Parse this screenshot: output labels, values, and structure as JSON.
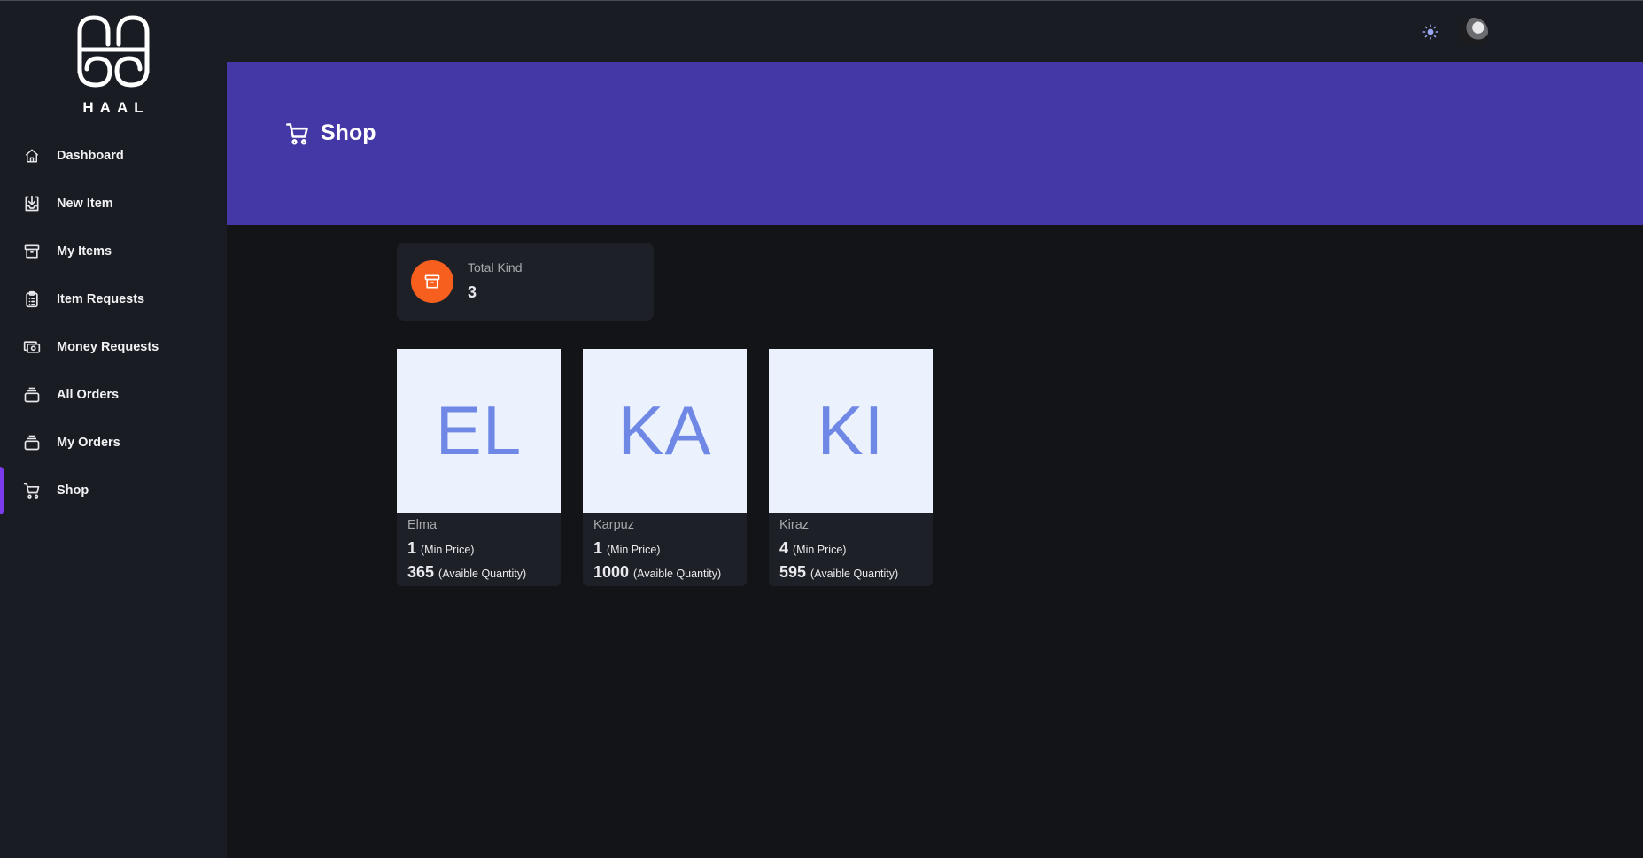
{
  "brand": {
    "name": "HAAL"
  },
  "sidebar": {
    "items": [
      {
        "label": "Dashboard",
        "icon": "home-icon"
      },
      {
        "label": "New Item",
        "icon": "download-box-icon"
      },
      {
        "label": "My Items",
        "icon": "archive-icon"
      },
      {
        "label": "Item Requests",
        "icon": "clipboard-list-icon"
      },
      {
        "label": "Money Requests",
        "icon": "cash-icon"
      },
      {
        "label": "All Orders",
        "icon": "stack-icon"
      },
      {
        "label": "My Orders",
        "icon": "stack-icon"
      },
      {
        "label": "Shop",
        "icon": "cart-icon",
        "active": true
      }
    ]
  },
  "topbar": {
    "theme_icon": "sun-icon",
    "avatar": "user-avatar"
  },
  "header": {
    "title": "Shop",
    "icon": "cart-icon",
    "color": "#4437a6"
  },
  "stats": {
    "label": "Total Kind",
    "value": "3",
    "icon": "archive-icon",
    "color": "#f75f1e"
  },
  "products": [
    {
      "initials": "EL",
      "name": "Elma",
      "min_price": "1",
      "min_price_label": "(Min Price)",
      "quantity": "365",
      "quantity_label": "(Avaible Quantity)"
    },
    {
      "initials": "KA",
      "name": "Karpuz",
      "min_price": "1",
      "min_price_label": "(Min Price)",
      "quantity": "1000",
      "quantity_label": "(Avaible Quantity)"
    },
    {
      "initials": "KI",
      "name": "Kiraz",
      "min_price": "4",
      "min_price_label": "(Min Price)",
      "quantity": "595",
      "quantity_label": "(Avaible Quantity)"
    }
  ],
  "colors": {
    "accent": "#7c3aed",
    "sidebar_bg": "#1a1c23",
    "page_bg": "#131418",
    "initials": "#6f88e6"
  }
}
